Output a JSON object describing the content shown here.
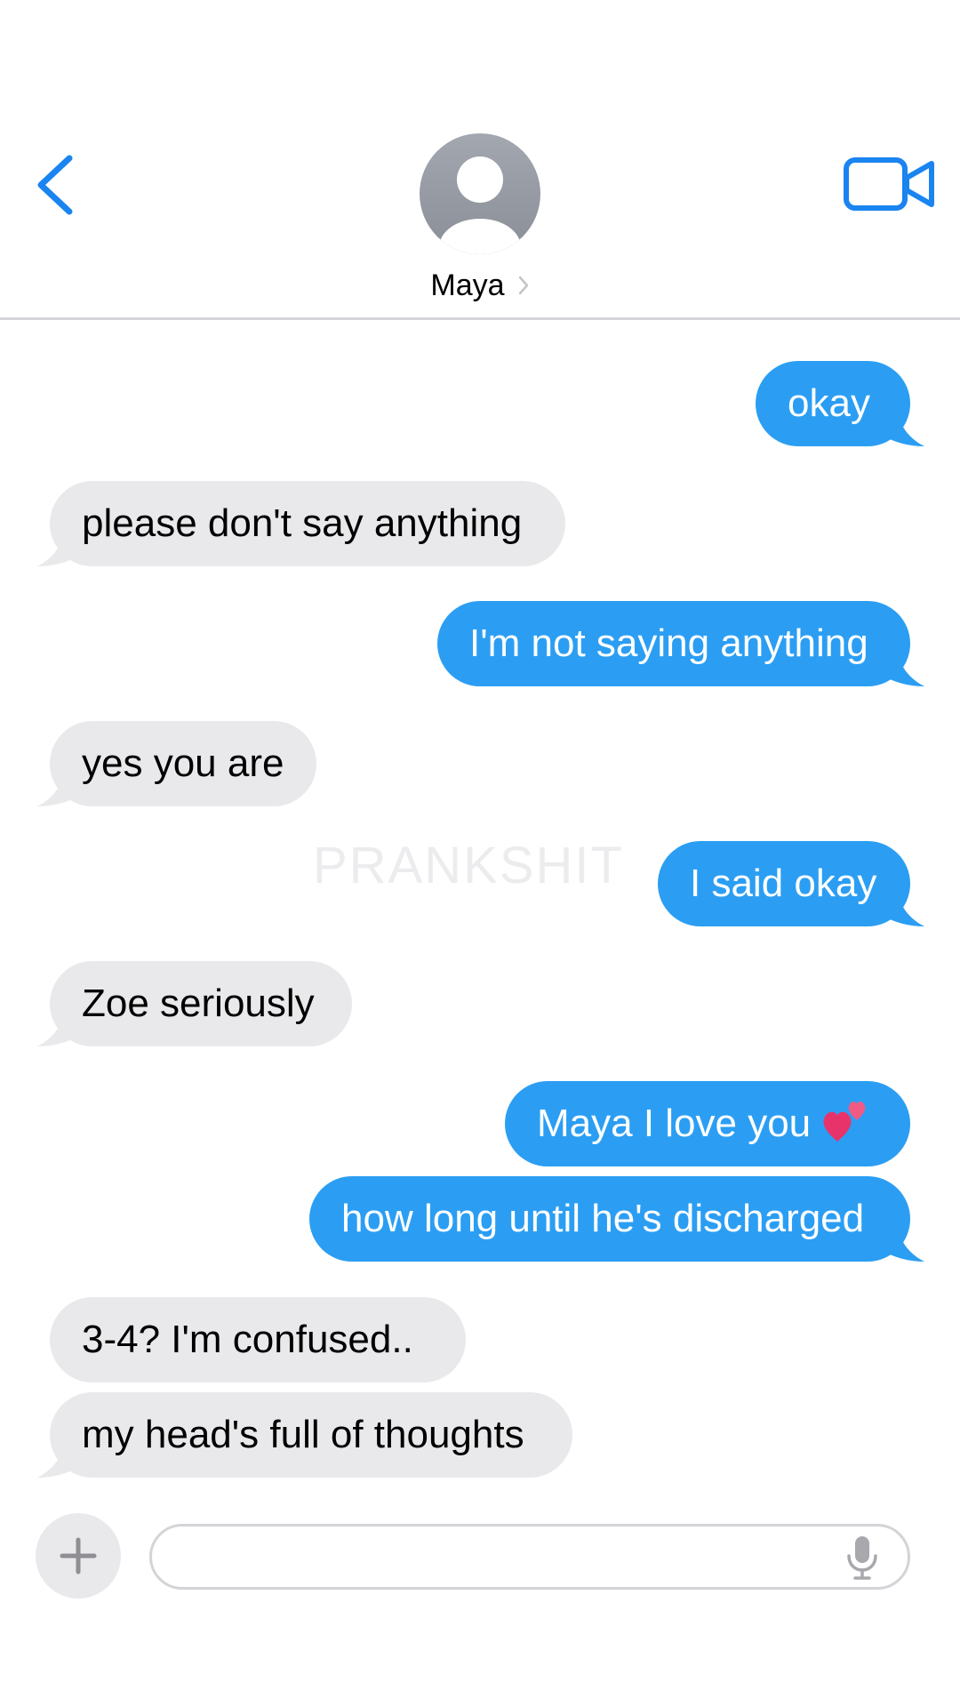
{
  "header": {
    "contact_name": "Maya",
    "back_icon": "chevron-left-icon",
    "video_icon": "video-camera-icon",
    "avatar_icon": "person-silhouette-icon",
    "name_chevron_icon": "chevron-right-icon"
  },
  "colors": {
    "accent": "#1a84f0",
    "sent_bubble": "#2b9ef3",
    "received_bubble": "#e9e9eb"
  },
  "watermark": "PRANKSHIT",
  "messages": [
    {
      "from": "me",
      "text": "okay"
    },
    {
      "from": "them",
      "text": "please don't say anything"
    },
    {
      "from": "me",
      "text": "I'm not saying anything"
    },
    {
      "from": "them",
      "text": "yes you are"
    },
    {
      "from": "me",
      "text": "I said okay"
    },
    {
      "from": "them",
      "text": "Zoe seriously"
    },
    {
      "from": "me",
      "text": "Maya I love you",
      "emoji": "two-hearts-icon"
    },
    {
      "from": "me",
      "text": "how long until he's discharged"
    },
    {
      "from": "them",
      "text": "3-4? I'm confused.."
    },
    {
      "from": "them",
      "text": "my head's full of thoughts"
    }
  ],
  "input": {
    "placeholder": "",
    "plus_icon": "plus-icon",
    "mic_icon": "microphone-icon"
  }
}
